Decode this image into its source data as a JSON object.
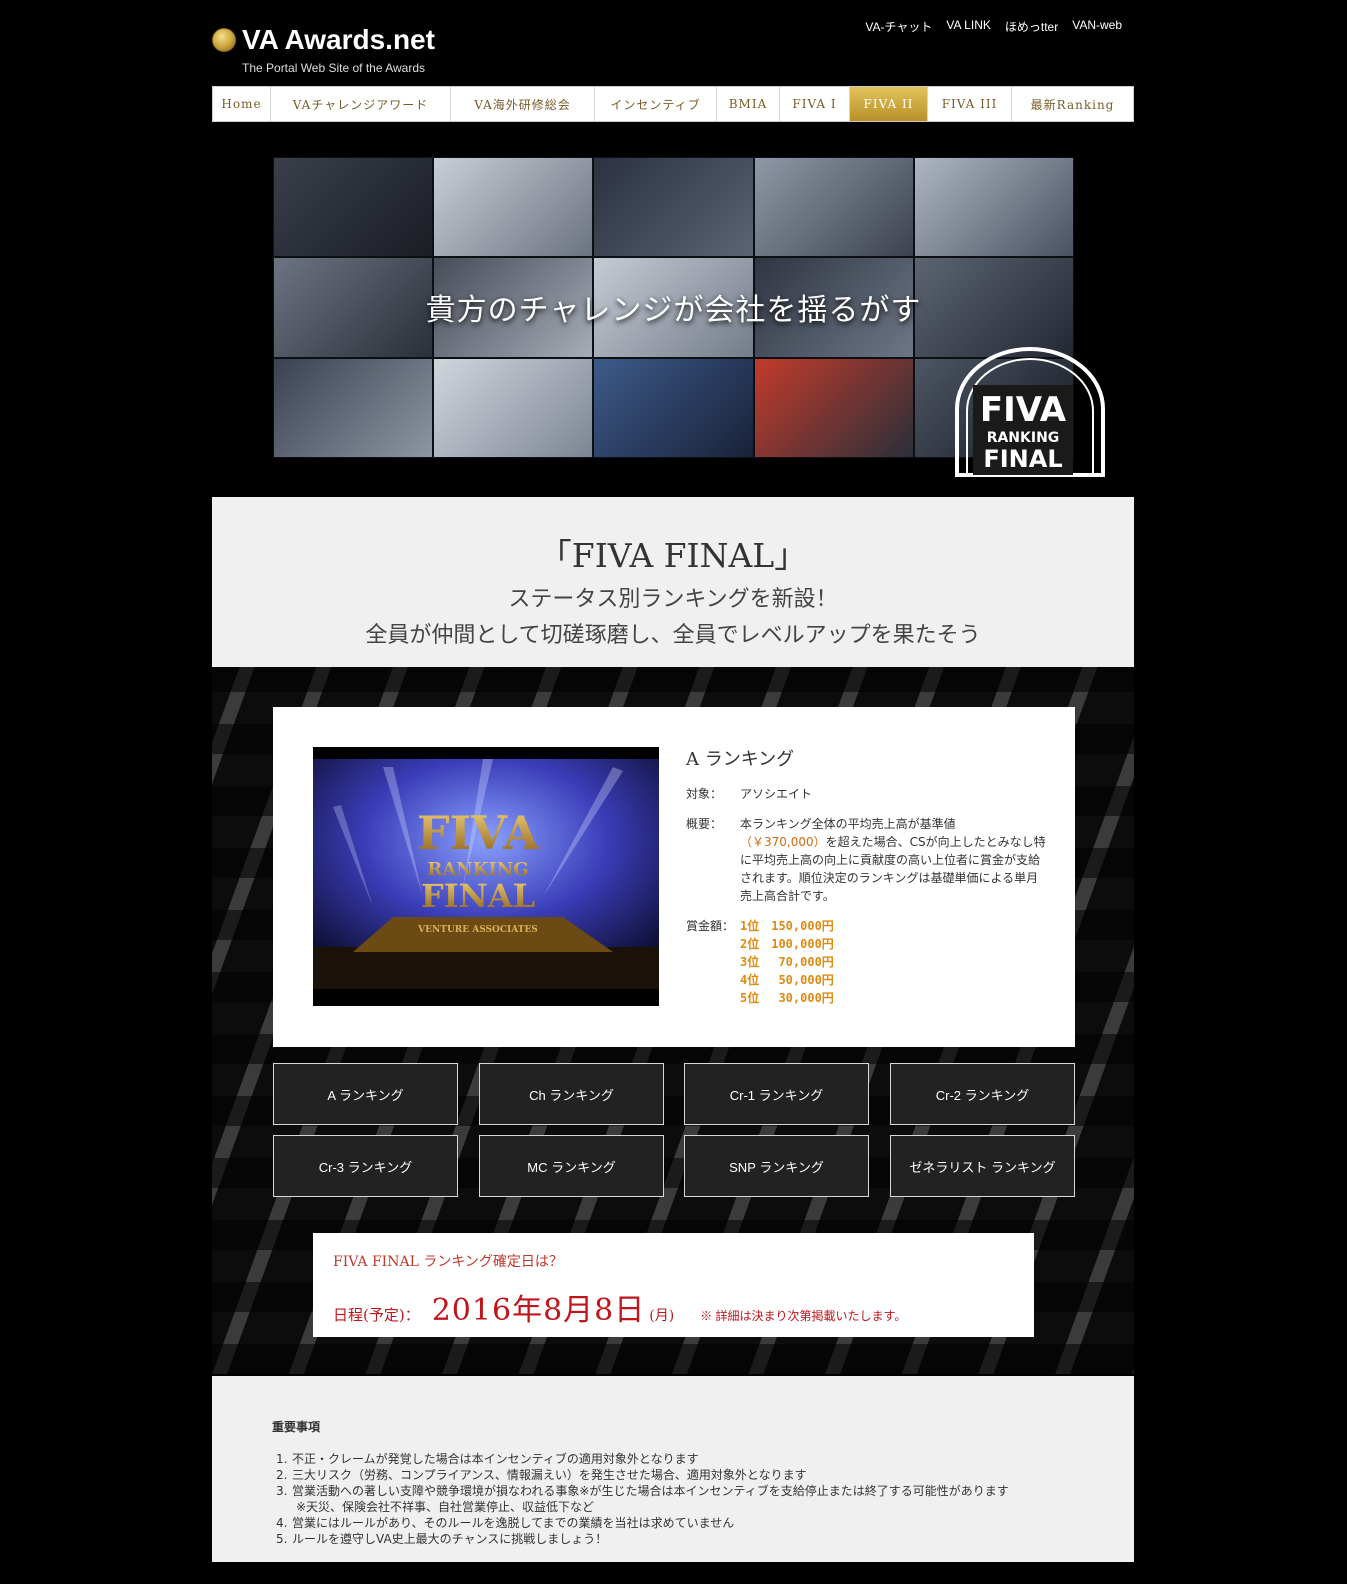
{
  "header": {
    "logo": "VA Awards.net",
    "tagline": "The Portal Web Site of the Awards",
    "toplinks": [
      "VA-チャット",
      "VA LINK",
      "ほめっtter",
      "VAN-web"
    ]
  },
  "nav": [
    "Home",
    "VAチャレンジアワード",
    "VA海外研修総会",
    "インセンティブ",
    "BMIA",
    "FIVA I",
    "FIVA II",
    "FIVA III",
    "最新Ranking"
  ],
  "hero": {
    "headline": "貴方のチャレンジが会社を揺るがす",
    "badge": {
      "line1": "FIVA",
      "line2": "RANKING",
      "line3": "FINAL"
    }
  },
  "intro": {
    "title": "「FIVA FINAL」",
    "sub1": "ステータス別ランキングを新設！",
    "sub2": "全員が仲間として切磋琢磨し、全員でレベルアップを果たそう"
  },
  "card": {
    "video_text": {
      "big1": "FIVA",
      "big2": "RANKING",
      "big3": "FINAL",
      "caption": "VENTURE ASSOCIATES"
    },
    "title": "A ランキング",
    "target_label": "対象：",
    "target_value": "アソシエイト",
    "summary_label": "概要：",
    "summary_pre": "本ランキング全体の平均売上高が基準値",
    "summary_price": "（￥370,000）",
    "summary_post": "を超えた場合、CSが向上したとみなし特に平均売上高の向上に貢献度の高い上位者に賞金が支給されます。順位決定のランキングは基礎単価による単月売上高合計です。",
    "prize_label": "賞金額：",
    "prizes": [
      "1位　150,000円",
      "2位　100,000円",
      "3位　 70,000円",
      "4位　 50,000円",
      "5位　 30,000円"
    ]
  },
  "buttons": [
    "A ランキング",
    "Ch ランキング",
    "Cr-1 ランキング",
    "Cr-2 ランキング",
    "Cr-3 ランキング",
    "MC ランキング",
    "SNP ランキング",
    "ゼネラリスト ランキング"
  ],
  "notice": {
    "question": "FIVA FINAL ランキング確定日は？",
    "label": "日程(予定)：",
    "date": "2016年8月8日",
    "day": "(月)",
    "note": "※ 詳細は決まり次第掲載いたします。"
  },
  "important": {
    "title": "重要事項",
    "items": [
      "不正・クレームが発覚した場合は本インセンティブの適用対象外となります",
      "三大リスク（労務、コンプライアンス、情報漏えい）を発生させた場合、適用対象外となります",
      "営業活動への著しい支障や競争環境が損なわれる事象※が生じた場合は本インセンティブを支給停止または終了する可能性があります",
      "営業にはルールがあり、そのルールを逸脱してまでの業績を当社は求めていません",
      "ルールを遵守しVA史上最大のチャンスに挑戦しましょう！"
    ],
    "sub_note": "※天災、保険会社不祥事、自社営業停止、収益低下など"
  }
}
